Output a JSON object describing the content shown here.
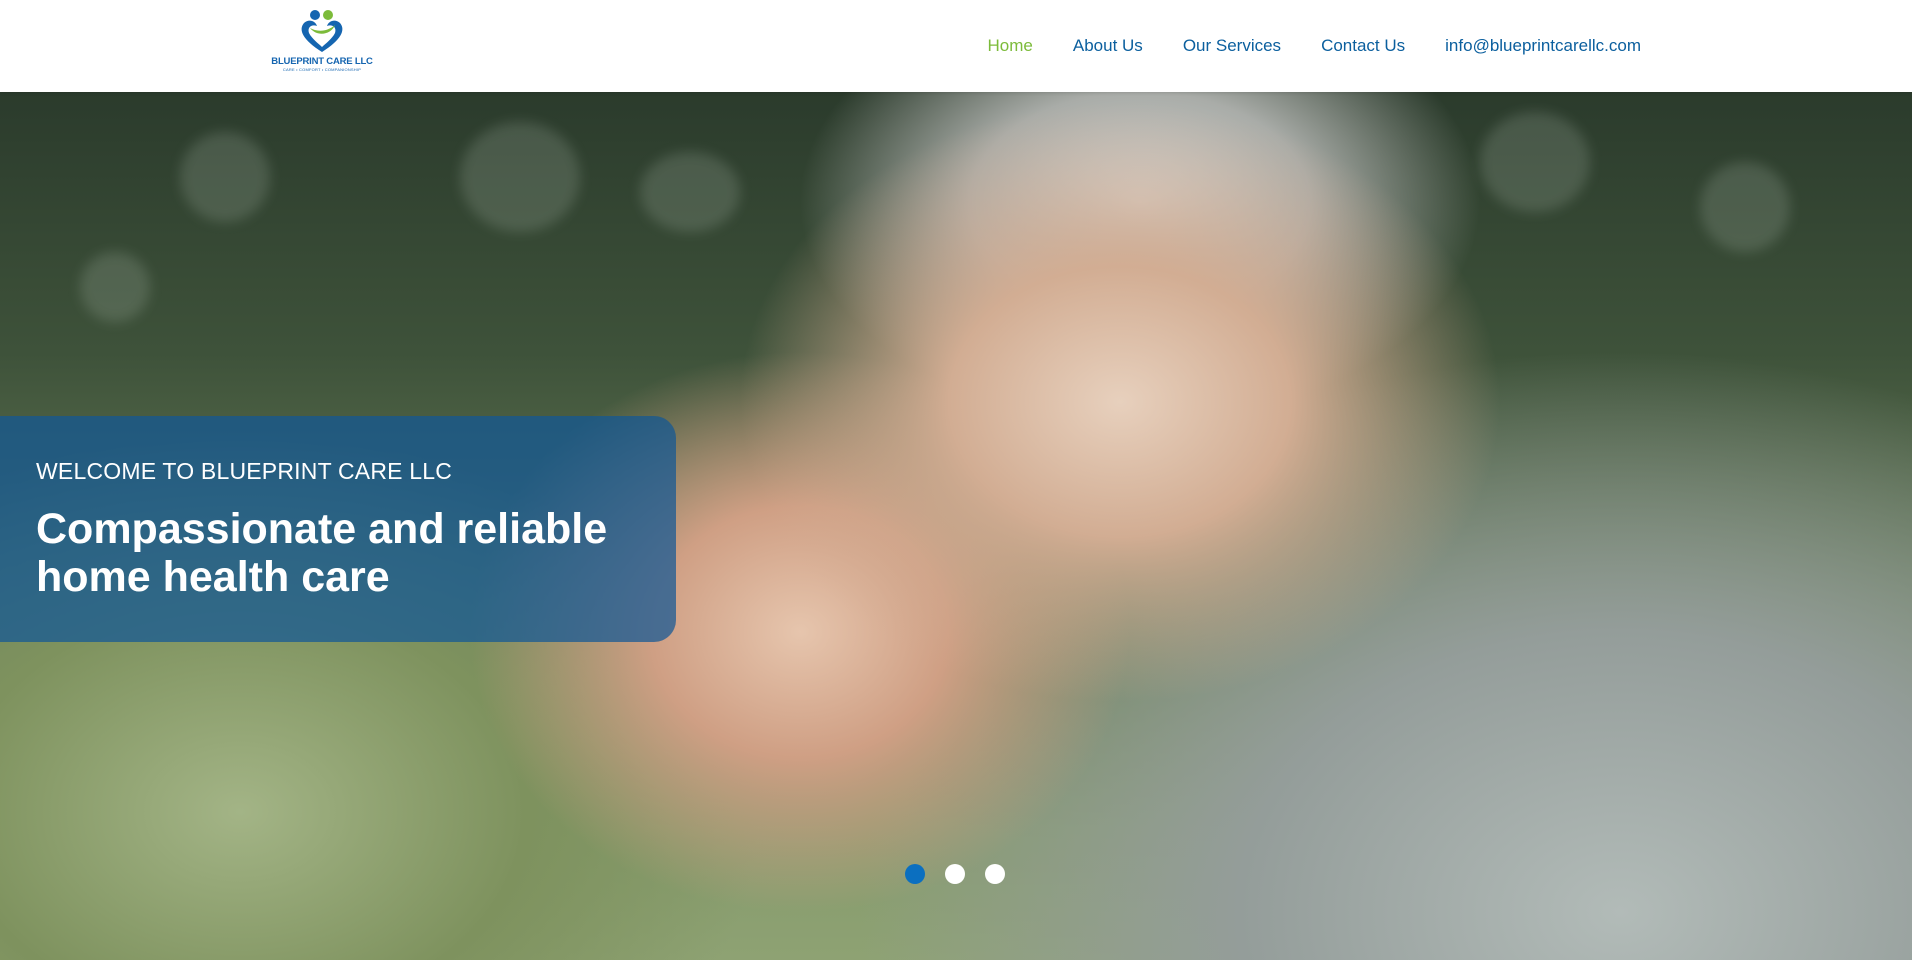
{
  "brand": {
    "name": "BLUEPRINT CARE LLC",
    "tagline": "CARE • COMFORT • COMPANIONSHIP",
    "colors": {
      "blue": "#1565b0",
      "green": "#7cbb3a"
    },
    "logo_icon": "heart-figures-icon"
  },
  "nav": {
    "items": [
      {
        "label": "Home",
        "active": true
      },
      {
        "label": "About Us",
        "active": false
      },
      {
        "label": "Our Services",
        "active": false
      },
      {
        "label": "Contact Us",
        "active": false
      },
      {
        "label": "info@blueprintcarellc.com",
        "active": false
      }
    ],
    "active_color": "#7cbb3a",
    "link_color": "#0b5f9e"
  },
  "hero": {
    "eyebrow": "WELCOME TO BLUEPRINT CARE LLC",
    "headline": "Compassionate and reliable home health care",
    "image": "photo-two-men-foreheads-touching",
    "slider": {
      "slide_count": 3,
      "current": 1,
      "active_color": "#0b6fc0"
    }
  }
}
